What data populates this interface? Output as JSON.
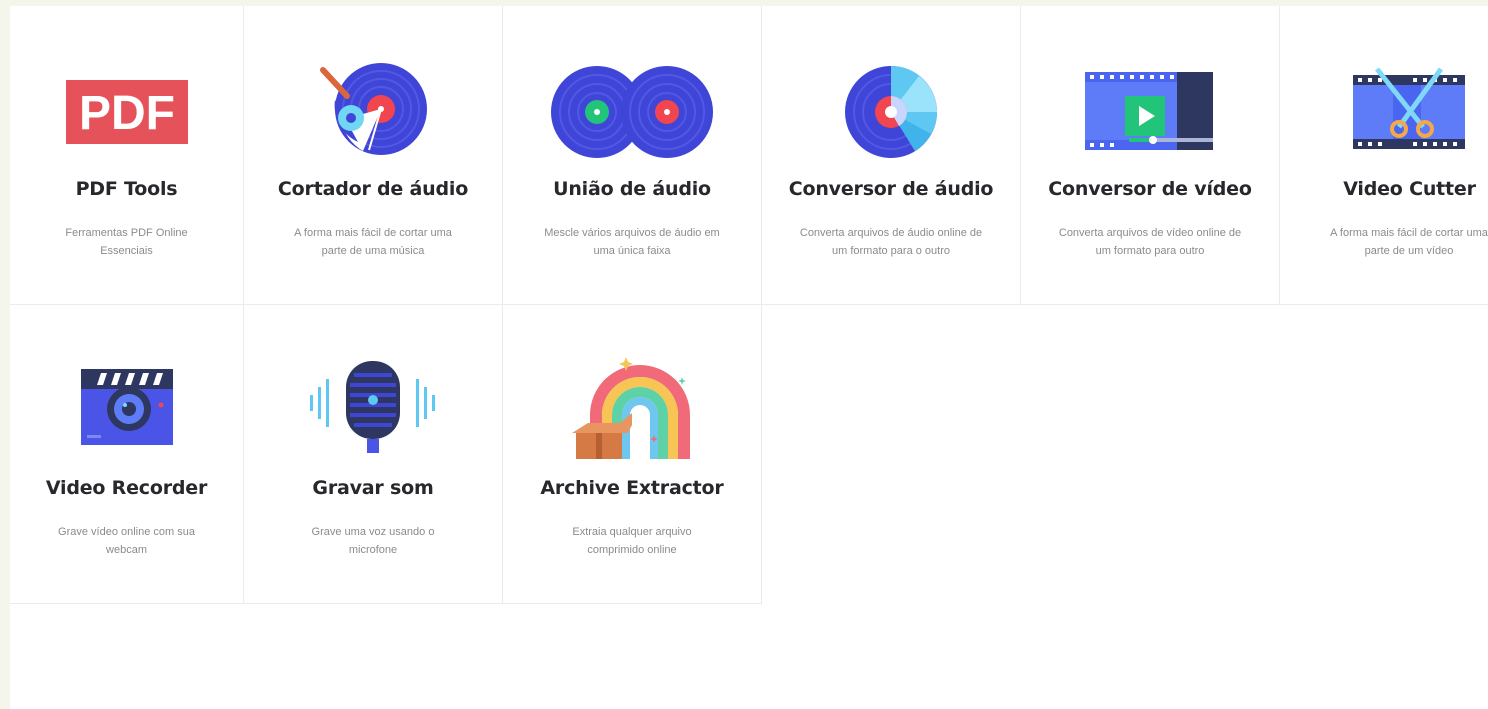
{
  "tools": [
    {
      "name": "pdf-tools",
      "title": "PDF Tools",
      "desc": "Ferramentas PDF Online Essenciais",
      "icon": "pdf-icon",
      "pdf_text": "PDF"
    },
    {
      "name": "audio-cutter",
      "title": "Cortador de áudio",
      "desc": "A forma mais fácil de cortar uma parte de uma música",
      "icon": "vinyl-cut-icon"
    },
    {
      "name": "audio-joiner",
      "title": "União de áudio",
      "desc": "Mescle vários arquivos de áudio em uma única faixa",
      "icon": "double-vinyl-icon"
    },
    {
      "name": "audio-converter",
      "title": "Conversor de áudio",
      "desc": "Converta arquivos de áudio online de um formato para o outro",
      "icon": "vinyl-cd-icon"
    },
    {
      "name": "video-converter",
      "title": "Conversor de vídeo",
      "desc": "Converta arquivos de vídeo online de um formato para outro",
      "icon": "video-player-icon"
    },
    {
      "name": "video-cutter",
      "title": "Video Cutter",
      "desc": "A forma mais fácil de cortar uma parte de um vídeo",
      "icon": "film-scissors-icon"
    },
    {
      "name": "video-recorder",
      "title": "Video Recorder",
      "desc": "Grave vídeo online com sua webcam",
      "icon": "clapperboard-camera-icon"
    },
    {
      "name": "voice-recorder",
      "title": "Gravar som",
      "desc": "Grave uma voz usando o microfone",
      "icon": "microphone-icon"
    },
    {
      "name": "archive-extractor",
      "title": "Archive Extractor",
      "desc": "Extraia qualquer arquivo comprimido online",
      "icon": "rainbow-box-icon"
    }
  ],
  "colors": {
    "page_bg": "#f4f6ec",
    "card_bg": "#ffffff",
    "title": "#27282c",
    "desc": "#8b8b8b",
    "pdf_red": "#e6525a",
    "vinyl_blue": "#3f45d6",
    "red_label": "#f1454f",
    "green_label": "#22c47a"
  }
}
